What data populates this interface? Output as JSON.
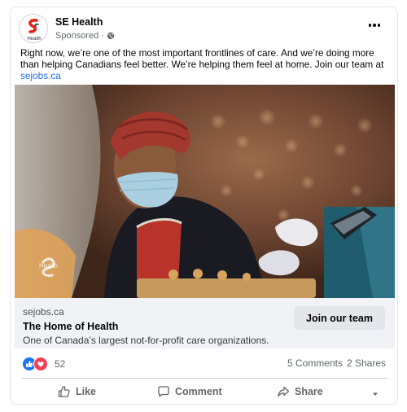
{
  "post": {
    "page_name": "SE Health",
    "sponsored": "Sponsored",
    "sponsored_sep": "·",
    "logo_text": "Health",
    "text": "Right now, we’re one of the most important frontlines of care. And we’re doing more than helping Canadians feel better. We’re helping them feel at home. Join our team at ",
    "text_link": "sejobs.ca",
    "media_watermark": "Health"
  },
  "link_preview": {
    "domain": "sejobs.ca",
    "title": "The Home of Health",
    "description": "One of Canada’s largest not-for-profit care organizations.",
    "cta_label": "Join our team"
  },
  "stats": {
    "reaction_count": "52",
    "comments": "5 Comments",
    "shares": "2 Shares"
  },
  "actions": {
    "like": "Like",
    "comment": "Comment",
    "share": "Share"
  },
  "icons": {
    "globe": "globe-icon",
    "more": "more-options-icon",
    "like_reaction": "thumbs-up-icon",
    "love_reaction": "heart-icon",
    "like_action": "thumbs-up-outline-icon",
    "comment_action": "speech-bubble-icon",
    "share_action": "share-arrow-icon",
    "caret": "caret-down-icon"
  },
  "colors": {
    "brand_red": "#e2231a",
    "link_blue": "#216fdb",
    "like_blue": "#1877f2",
    "love_red": "#f33e58",
    "muted_text": "#65676b",
    "preview_bg": "#f0f2f5",
    "button_bg": "#e4e6eb"
  }
}
